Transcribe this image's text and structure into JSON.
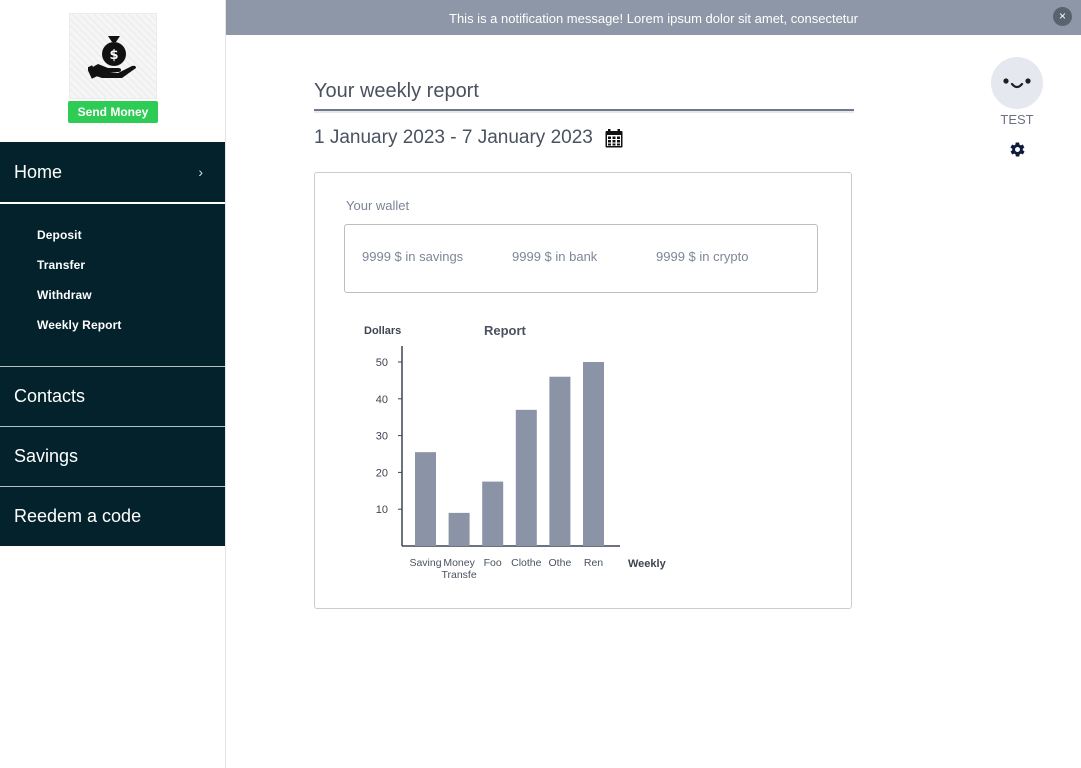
{
  "sidebar": {
    "logo_icon": "money-bag-hand-icon",
    "send_money_label": "Send Money",
    "home": {
      "label": "Home",
      "chevron": "›"
    },
    "sub_items": [
      {
        "label": "Deposit"
      },
      {
        "label": "Transfer"
      },
      {
        "label": "Withdraw"
      },
      {
        "label": "Weekly Report"
      }
    ],
    "blocks": [
      {
        "label": "Contacts"
      },
      {
        "label": "Savings"
      },
      {
        "label": "Reedem a code"
      }
    ]
  },
  "notification": {
    "message": "This is a notification message! Lorem ipsum dolor sit amet, consectetur",
    "close_symbol": "×"
  },
  "header": {
    "title": "Your weekly report",
    "date_range": "1 January 2023 - 7 January 2023"
  },
  "profile": {
    "name": "TEST"
  },
  "wallet": {
    "label": "Your wallet",
    "items": [
      {
        "text": "9999 $ in savings"
      },
      {
        "text": "9999 $ in bank"
      },
      {
        "text": "9999 $ in crypto"
      }
    ]
  },
  "colors": {
    "sidebar_bg": "#03222b",
    "accent_green": "#2ecc54",
    "bar": "#8a94a6",
    "notification_bg": "#8e97a7"
  },
  "chart_data": {
    "type": "bar",
    "title": "Report",
    "ylabel": "Dollars",
    "xlabel": "Weekly",
    "ylim": [
      0,
      50
    ],
    "yticks": [
      10,
      20,
      30,
      40,
      50
    ],
    "categories": [
      [
        "Saving"
      ],
      [
        "Money",
        "Transfe"
      ],
      [
        "Foo"
      ],
      [
        "Clothe"
      ],
      [
        "Othe"
      ],
      [
        "Ren"
      ]
    ],
    "values": [
      25.5,
      9,
      17.5,
      37,
      46,
      50
    ],
    "grid": false,
    "legend": "none"
  }
}
